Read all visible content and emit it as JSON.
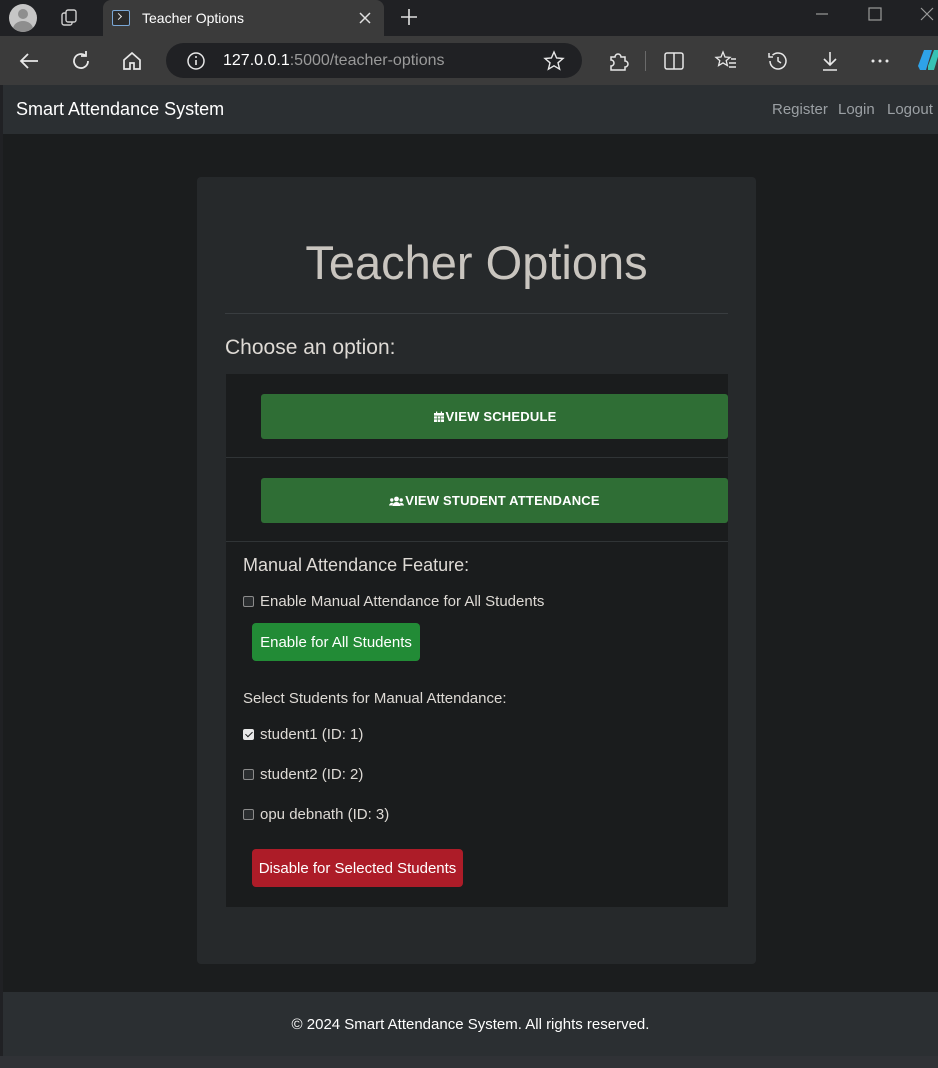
{
  "browser": {
    "tab_title": "Teacher Options",
    "url_host": "127.0.0.1",
    "url_rest": ":5000/teacher-options"
  },
  "navbar": {
    "brand": "Smart Attendance System",
    "links": [
      "Register",
      "Login",
      "Logout"
    ]
  },
  "main": {
    "title": "Teacher Options",
    "choose_label": "Choose an option:",
    "options": [
      {
        "label": "VIEW SCHEDULE",
        "icon": "calendar-icon"
      },
      {
        "label": "VIEW STUDENT ATTENDANCE",
        "icon": "users-icon"
      }
    ],
    "manual": {
      "title": "Manual Attendance Feature:",
      "enable_all_checkbox_label": "Enable Manual Attendance for All Students",
      "enable_all_checked": false,
      "enable_all_button": "Enable for All Students",
      "select_label": "Select Students for Manual Attendance:",
      "students": [
        {
          "label": "student1 (ID: 1)",
          "checked": true
        },
        {
          "label": "student2 (ID: 2)",
          "checked": false
        },
        {
          "label": "opu debnath (ID: 3)",
          "checked": false
        }
      ],
      "disable_button": "Disable for Selected Students"
    }
  },
  "footer": {
    "text": "© 2024 Smart Attendance System. All rights reserved."
  },
  "colors": {
    "option_button": "#2f6e35",
    "enable_button": "#228b36",
    "disable_button": "#ad1c28"
  }
}
